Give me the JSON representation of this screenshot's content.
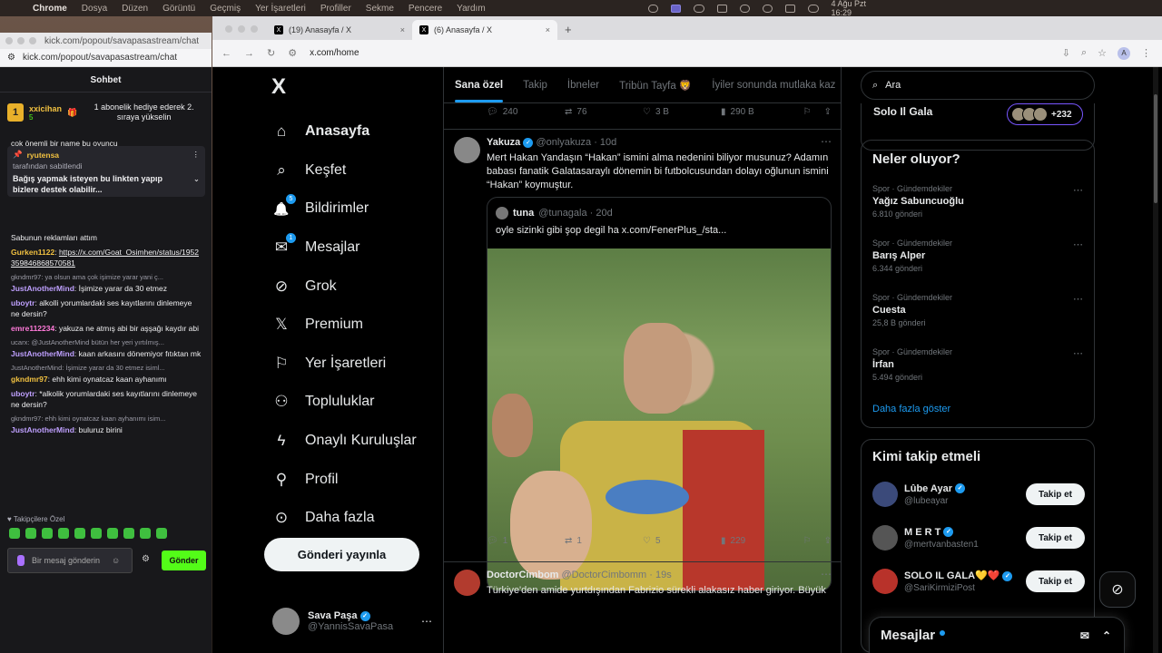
{
  "menubar": {
    "app": "Chrome",
    "items": [
      "Dosya",
      "Düzen",
      "Görüntü",
      "Geçmiş",
      "Yer İşaretleri",
      "Profiller",
      "Sekme",
      "Pencere",
      "Yardım"
    ],
    "clock": "4 Ağu Pzt  16:29"
  },
  "chat_window": {
    "title": "kick.com/popout/savapasastream/chat",
    "url": "kick.com/popout/savapasastream/chat",
    "header": "Sohbet",
    "gift": {
      "badge": "1",
      "user": "xxicihan",
      "count": "5",
      "text": "1 abonelik hediye ederek 2. sıraya yükselin"
    },
    "cut_message": "çok önemli bir name bu oyuncu",
    "pinned": {
      "user": "ryutensa",
      "sub": "tarafından sabitlendi",
      "message": "Bağış yapmak isteyen bu linkten yapıp bizlere destek olabilir..."
    },
    "messages": [
      {
        "reply": "",
        "user": "",
        "text": "Sabunun reklamları attım",
        "color": "#efeff1"
      },
      {
        "reply": "",
        "user": "Gurken1122",
        "text": "https://x.com/Goat_Osimhen/status/1952359846868570581",
        "color": "#f0c040",
        "link": true
      },
      {
        "reply": "gkndmr97: ya olsun ama çok işimize yarar yani ç...",
        "user": "JustAnotherMind",
        "text": "İşimize yarar da 30 etmez",
        "color": "#bfa0ff"
      },
      {
        "reply": "",
        "user": "uboytr",
        "text": "alkolli yorumlardaki ses kayıtlarını dinlemeye ne dersin?",
        "color": "#bfa0ff"
      },
      {
        "reply": "",
        "user": "emre112234",
        "text": "yakuza ne atmış abi bir aşşağı kaydır abi",
        "color": "#ff7ad9"
      },
      {
        "reply": "ucarx: @JustAnotherMind bütün her yeri yırtılmış...",
        "user": "JustAnotherMind",
        "text": "kaan arkasını dönemiyor fıtıktan mk",
        "color": "#bfa0ff"
      },
      {
        "reply": "JustAnotherMind: İşimize yarar da 30 etmez isiml...",
        "user": "gkndmr97",
        "text": "ehh kimi oynatcaz kaan ayhanımı",
        "color": "#f0c040"
      },
      {
        "reply": "",
        "user": "uboytr",
        "text": "*alkolik yorumlardaki ses kayıtlarını dinlemeye ne dersin?",
        "color": "#bfa0ff"
      },
      {
        "reply": "gkndmr97: ehh kimi oynatcaz kaan ayhanımı isim...",
        "user": "JustAnotherMind",
        "text": "buluruz birini",
        "color": "#bfa0ff"
      }
    ],
    "footer_label": "Takipçilere Özel",
    "input_placeholder": "Bir mesaj gönderin",
    "send_label": "Gönder",
    "accent": "#53fc18"
  },
  "browser": {
    "tabs": [
      {
        "label": "(19) Anasayfa / X"
      },
      {
        "label": "(6) Anasayfa / X"
      }
    ],
    "url": "x.com/home",
    "profile_initial": "A"
  },
  "x": {
    "logo": "X",
    "nav": [
      {
        "label": "Anasayfa",
        "icon": "home-icon",
        "glyph": "⌂"
      },
      {
        "label": "Keşfet",
        "icon": "search-icon",
        "glyph": "⌕"
      },
      {
        "label": "Bildirimler",
        "icon": "bell-icon",
        "glyph": "🔔",
        "badge": "5"
      },
      {
        "label": "Mesajlar",
        "icon": "mail-icon",
        "glyph": "✉",
        "badge": "1"
      },
      {
        "label": "Grok",
        "icon": "grok-icon",
        "glyph": "⊘"
      },
      {
        "label": "Premium",
        "icon": "x-premium-icon",
        "glyph": "𝕏"
      },
      {
        "label": "Yer İşaretleri",
        "icon": "bookmark-icon",
        "glyph": "⚐"
      },
      {
        "label": "Topluluklar",
        "icon": "communities-icon",
        "glyph": "⚇"
      },
      {
        "label": "Onaylı Kuruluşlar",
        "icon": "lightning-icon",
        "glyph": "ϟ"
      },
      {
        "label": "Profil",
        "icon": "person-icon",
        "glyph": "⚲"
      },
      {
        "label": "Daha fazla",
        "icon": "more-circle-icon",
        "glyph": "⊙"
      }
    ],
    "post_button": "Gönderi yayınla",
    "profile": {
      "name": "Sava Paşa",
      "handle": "@YannisSavaPasa"
    },
    "feed_tabs": [
      "Sana özel",
      "Takip",
      "İbneler",
      "Tribün Tayfa 🦁",
      "İyiler sonunda mutlaka kaz"
    ],
    "tweet1_actions": {
      "replies": "240",
      "reposts": "76",
      "likes": "3 B",
      "views": "290 B"
    },
    "tweet2": {
      "name": "Yakuza",
      "handle": "@onlyakuza · 10d",
      "text": "Mert Hakan Yandaşın “Hakan” ismini alma nedenini biliyor musunuz? Adamın babası fanatik Galatasaraylı dönemin bi futbolcusundan dolayı oğlunun ismini “Hakan” koymuştur.",
      "quote_name": "tuna",
      "quote_handle": "@tunagala · 20d",
      "quote_text": "oyle sizinki gibi şop degil ha  x.com/FenerPlus_/sta...",
      "replies": "1",
      "reposts": "1",
      "likes": "5",
      "views": "229"
    },
    "tweet3": {
      "name": "DoctorCimbom",
      "handle": "@DoctorCimbomm · 19s",
      "text": "Türkiye'den amide yurtdışından Fabrizio sürekli alakasız haber giriyor. Büyük"
    },
    "search_placeholder": "Ara",
    "solo_card_title": "Solo Il Gala",
    "solo_card_count": "+232",
    "trends_title": "Neler oluyor?",
    "trends": [
      {
        "cat": "Spor · Gündemdekiler",
        "name": "Yağız Sabuncuoğlu",
        "count": "6.810 gönderi"
      },
      {
        "cat": "Spor · Gündemdekiler",
        "name": "Barış Alper",
        "count": "6.344 gönderi"
      },
      {
        "cat": "Spor · Gündemdekiler",
        "name": "Cuesta",
        "count": "25,8 B gönderi"
      },
      {
        "cat": "Spor · Gündemdekiler",
        "name": "İrfan",
        "count": "5.494 gönderi"
      }
    ],
    "trends_more": "Daha fazla göster",
    "follow_title": "Kimi takip etmeli",
    "follow": [
      {
        "name": "Lûbe Ayar",
        "handle": "@lubeayar",
        "btn": "Takip et"
      },
      {
        "name": "M E R T",
        "handle": "@mertvanbasten1",
        "btn": "Takip et"
      },
      {
        "name": "SOLO IL GALA💛❤️",
        "handle": "@SariKirmiziPost",
        "btn": "Takip et"
      }
    ],
    "dm_bar": "Mesajlar",
    "accent": "#1d9bf0"
  }
}
